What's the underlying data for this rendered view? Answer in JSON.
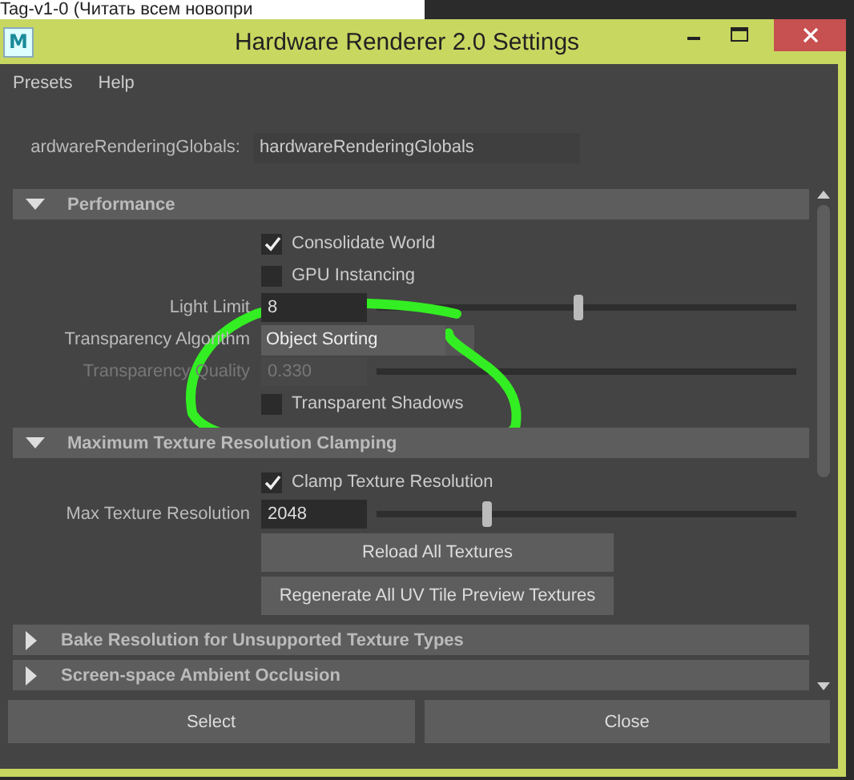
{
  "background": {
    "text": "Tag-v1-0 (Читать всем новопри"
  },
  "window": {
    "logo": "M",
    "title": "Hardware Renderer 2.0 Settings"
  },
  "menu": [
    "Presets",
    "Help"
  ],
  "node": {
    "label": "ardwareRenderingGlobals:",
    "value": "hardwareRenderingGlobals"
  },
  "sections": [
    {
      "title": "Performance",
      "expanded": true,
      "rows": [
        {
          "kind": "checkbox",
          "label": "Consolidate World",
          "checked": true
        },
        {
          "kind": "checkbox",
          "label": "GPU Instancing",
          "checked": false
        },
        {
          "kind": "slider",
          "label": "Light Limit",
          "value": "8",
          "level": 0.47,
          "disabled": false
        },
        {
          "kind": "dropdown",
          "label": "Transparency Algorithm",
          "value": "Object Sorting"
        },
        {
          "kind": "slider",
          "label": "Transparency Quality",
          "value": "0.330",
          "disabled": true
        },
        {
          "kind": "checkbox",
          "label": "Transparent Shadows",
          "checked": false
        }
      ]
    },
    {
      "title": "Maximum Texture Resolution Clamping",
      "expanded": true,
      "rows": [
        {
          "kind": "checkbox",
          "label": "Clamp Texture Resolution",
          "checked": true
        },
        {
          "kind": "slider",
          "label": "Max Texture Resolution",
          "value": "2048",
          "level": 0.25,
          "disabled": false
        },
        {
          "kind": "button",
          "label": "Reload All Textures"
        },
        {
          "kind": "button",
          "label": "Regenerate All UV Tile Preview Textures"
        }
      ]
    },
    {
      "title": "Bake Resolution for Unsupported Texture Types",
      "expanded": false
    },
    {
      "title": "Screen-space Ambient Occlusion",
      "expanded": false
    }
  ],
  "buttons": [
    "Select",
    "Close"
  ]
}
